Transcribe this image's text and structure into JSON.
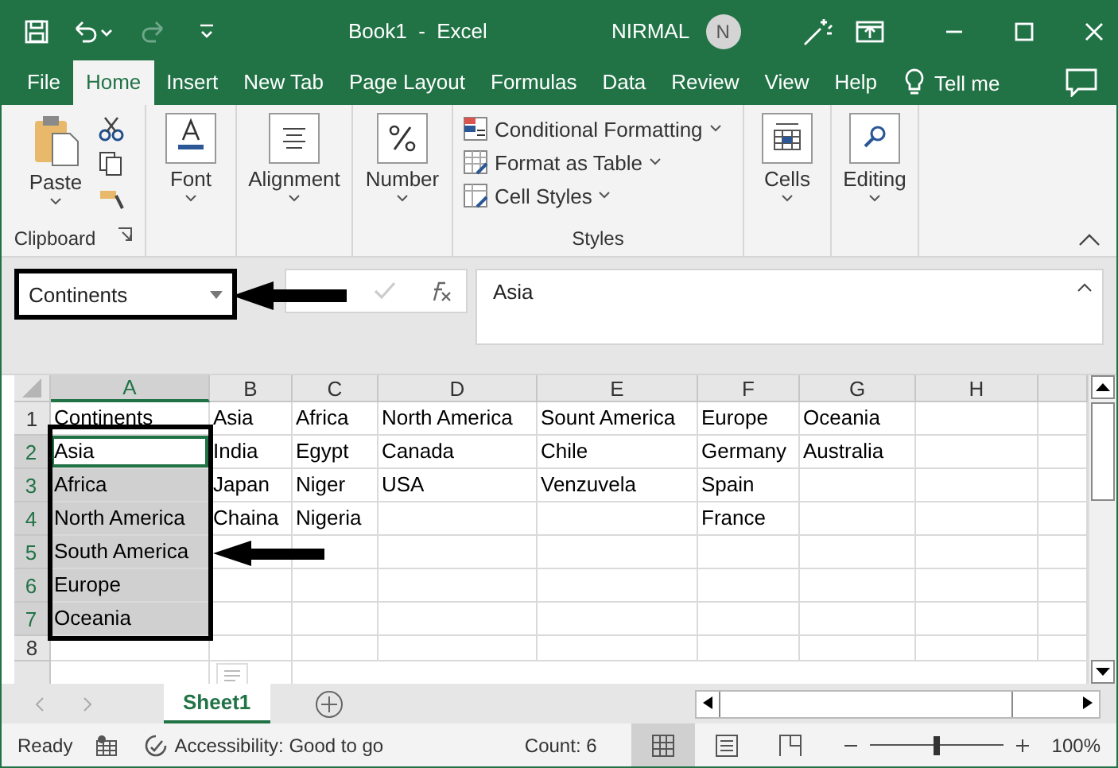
{
  "title_bar": {
    "title": "Book1  -  Excel",
    "user": "NIRMAL",
    "avatar": "N"
  },
  "ribbon_tabs": [
    {
      "label": "File",
      "selected": false
    },
    {
      "label": "Home",
      "selected": true
    },
    {
      "label": "Insert",
      "selected": false
    },
    {
      "label": "New Tab",
      "selected": false
    },
    {
      "label": "Page Layout",
      "selected": false
    },
    {
      "label": "Formulas",
      "selected": false
    },
    {
      "label": "Data",
      "selected": false
    },
    {
      "label": "Review",
      "selected": false
    },
    {
      "label": "View",
      "selected": false
    },
    {
      "label": "Help",
      "selected": false
    }
  ],
  "tell_me": "Tell me",
  "ribbon": {
    "clipboard": {
      "paste": "Paste",
      "label": "Clipboard"
    },
    "big_buttons": [
      {
        "kind": "font",
        "label": "Font"
      },
      {
        "kind": "alignment",
        "label": "Alignment"
      },
      {
        "kind": "number",
        "label": "Number"
      }
    ],
    "styles": {
      "items": [
        "Conditional Formatting",
        "Format as Table",
        "Cell Styles"
      ],
      "label": "Styles"
    },
    "end_buttons": [
      {
        "kind": "cells",
        "label": "Cells"
      },
      {
        "kind": "editing",
        "label": "Editing"
      }
    ]
  },
  "name_box": "Continents",
  "formula": "Asia",
  "columns": [
    {
      "label": "A",
      "selected": true
    },
    {
      "label": "B",
      "selected": false
    },
    {
      "label": "C",
      "selected": false
    },
    {
      "label": "D",
      "selected": false
    },
    {
      "label": "E",
      "selected": false
    },
    {
      "label": "F",
      "selected": false
    },
    {
      "label": "G",
      "selected": false
    },
    {
      "label": "H",
      "selected": false
    }
  ],
  "rows": [
    {
      "number": "1",
      "selected": false,
      "active": false,
      "cells": [
        "Continents",
        "Asia",
        "Africa",
        "North America",
        "Sount America",
        "Europe",
        "Oceania"
      ]
    },
    {
      "number": "2",
      "selected": true,
      "active": true,
      "cells": [
        "Asia",
        "India",
        "Egypt",
        "Canada",
        "Chile",
        "Germany",
        "Australia"
      ]
    },
    {
      "number": "3",
      "selected": true,
      "active": false,
      "cells": [
        "Africa",
        "Japan",
        "Niger",
        "USA",
        "Venzuvela",
        "Spain"
      ]
    },
    {
      "number": "4",
      "selected": true,
      "active": false,
      "cells": [
        "North America",
        "Chaina",
        "Nigeria",
        "",
        "",
        "France"
      ]
    },
    {
      "number": "5",
      "selected": true,
      "active": false,
      "cells": [
        "South America"
      ]
    },
    {
      "number": "6",
      "selected": true,
      "active": false,
      "cells": [
        "Europe"
      ]
    },
    {
      "number": "7",
      "selected": true,
      "active": false,
      "cells": [
        "Oceania"
      ]
    },
    {
      "number": "8",
      "selected": false,
      "active": false,
      "cells": []
    }
  ],
  "sheet_tabs": [
    {
      "label": "Sheet1",
      "selected": true
    }
  ],
  "status_bar": {
    "mode": "Ready",
    "accessibility": "Accessibility: Good to go",
    "count": "Count: 6",
    "zoom": "100%",
    "zoom_slider": {
      "level": 0.5
    }
  }
}
